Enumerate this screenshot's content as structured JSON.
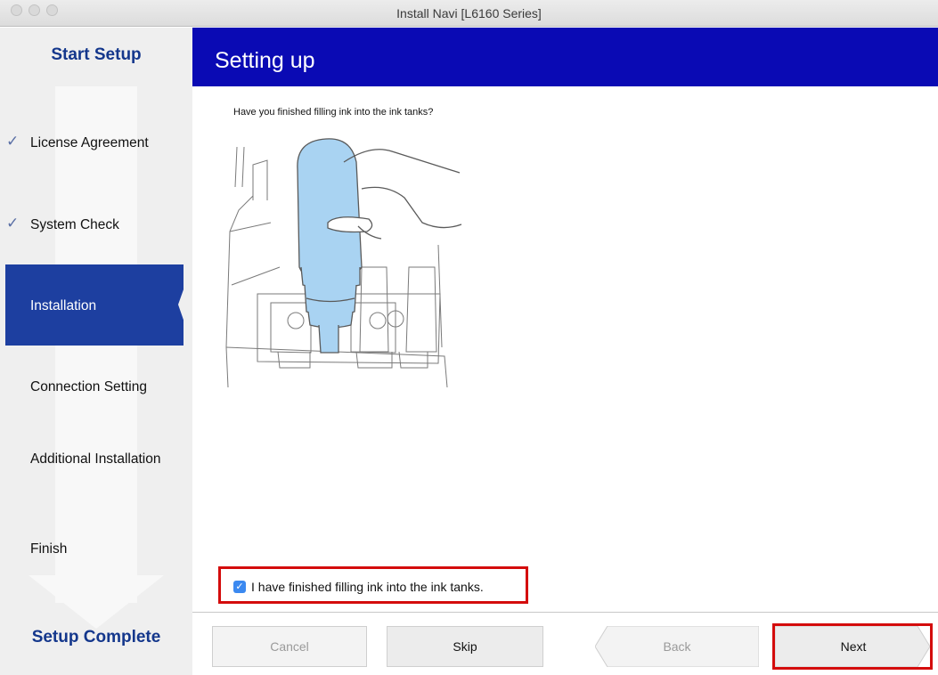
{
  "window": {
    "title": "Install Navi [L6160 Series]"
  },
  "sidebar": {
    "start_label": "Start Setup",
    "complete_label": "Setup Complete",
    "steps": [
      {
        "label": "License Agreement",
        "state": "done"
      },
      {
        "label": "System Check",
        "state": "done"
      },
      {
        "label": "Installation",
        "state": "active"
      },
      {
        "label": "Connection Setting",
        "state": "pending"
      },
      {
        "label": "Additional Installation",
        "state": "pending"
      },
      {
        "label": "Finish",
        "state": "pending"
      }
    ],
    "check_glyph": "✓"
  },
  "header": {
    "title": "Setting up"
  },
  "main": {
    "question": "Have you finished filling ink into the ink tanks?",
    "confirm_checkbox": {
      "label": "I have finished filling ink into the ink tanks.",
      "checked": true,
      "glyph": "✓"
    }
  },
  "buttons": {
    "cancel": "Cancel",
    "skip": "Skip",
    "back": "Back",
    "next": "Next"
  },
  "colors": {
    "header_bg": "#0a0ab4",
    "active_step_bg": "#1d3fa0",
    "heading_blue": "#14378c",
    "highlight_red": "#d40c0c",
    "checkbox_blue": "#3b89f0",
    "ink_bottle": "#a9d3f2"
  }
}
